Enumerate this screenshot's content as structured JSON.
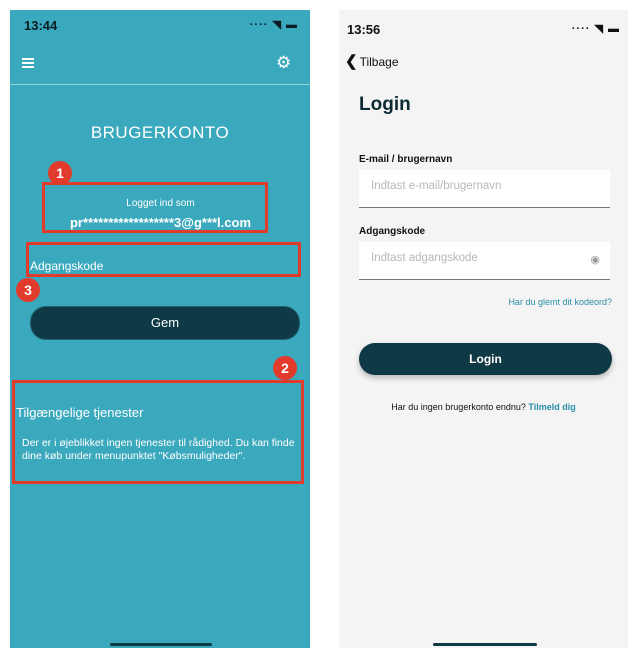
{
  "left_screen": {
    "status_time": "13:44",
    "status_icons": "···· ◥ ▬",
    "title": "BRUGERKONTO",
    "logged_in_label": "Logget ind som",
    "email": "pr******************3@g***l.com",
    "password_placeholder": "Adgangskode",
    "save_label": "Gem",
    "services_title": "Tilgængelige tjenester",
    "services_text": "Der er i øjeblikket ingen tjenester til rådighed. Du kan finde dine køb under menupunktet \"Købsmuligheder\".",
    "annotations": [
      "1",
      "2",
      "3"
    ],
    "annotation_color": "#e23b2b",
    "background_color": "#3ba9bd",
    "button_color": "#0f3a45"
  },
  "right_screen": {
    "status_time": "13:56",
    "status_icons": "···· ◥ ▬",
    "back_label": "Tilbage",
    "title": "Login",
    "email_label": "E-mail / brugernavn",
    "email_placeholder": "Indtast e-mail/brugernavn",
    "password_label": "Adgangskode",
    "password_placeholder": "Indtast adgangskode",
    "forgot_label": "Har du glemt dit kodeord?",
    "login_label": "Login",
    "no_account_text": "Har du ingen brugerkonto endnu?",
    "signup_link": "Tilmeld dig",
    "link_color": "#2a8ea6"
  }
}
